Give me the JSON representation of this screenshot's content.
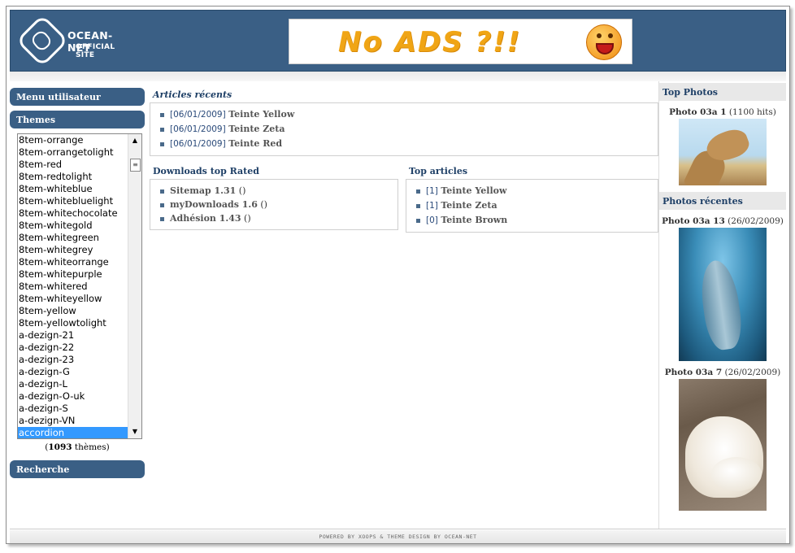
{
  "header": {
    "logo_title": "OCEAN-NET",
    "logo_subtitle": "OFFICIAL SITE",
    "banner_text": "No ADS ?!!",
    "brand_color": "#3a5f85"
  },
  "left": {
    "menu_title": "Menu utilisateur",
    "themes_title": "Themes",
    "themes": [
      "8tem-orrange",
      "8tem-orrangetolight",
      "8tem-red",
      "8tem-redtolight",
      "8tem-whiteblue",
      "8tem-whitebluelight",
      "8tem-whitechocolate",
      "8tem-whitegold",
      "8tem-whitegreen",
      "8tem-whitegrey",
      "8tem-whiteorrange",
      "8tem-whitepurple",
      "8tem-whitered",
      "8tem-whiteyellow",
      "8tem-yellow",
      "8tem-yellowtolight",
      "a-dezign-21",
      "a-dezign-22",
      "a-dezign-23",
      "a-dezign-G",
      "a-dezign-L",
      "a-dezign-O-uk",
      "a-dezign-S",
      "a-dezign-VN",
      "accordion"
    ],
    "selected_theme": "accordion",
    "theme_count_open": "(",
    "theme_count_number": "1093",
    "theme_count_suffix": " thèmes)",
    "search_title": "Recherche"
  },
  "center": {
    "recent_articles_title": "Articles récents",
    "recent_articles": [
      {
        "date": "[06/01/2009]",
        "title": "Teinte Yellow"
      },
      {
        "date": "[06/01/2009]",
        "title": "Teinte Zeta"
      },
      {
        "date": "[06/01/2009]",
        "title": "Teinte Red"
      }
    ],
    "downloads_title": "Downloads top Rated",
    "downloads": [
      {
        "name": "Sitemap 1.31",
        "extra": " ()"
      },
      {
        "name": "myDownloads 1.6",
        "extra": " ()"
      },
      {
        "name": "Adhésion 1.43",
        "extra": " ()"
      }
    ],
    "top_articles_title": "Top articles",
    "top_articles": [
      {
        "count": "[1]",
        "title": "Teinte Yellow"
      },
      {
        "count": "[1]",
        "title": "Teinte Zeta"
      },
      {
        "count": "[0]",
        "title": "Teinte Brown"
      }
    ]
  },
  "right": {
    "top_photos_title": "Top Photos",
    "top_photo_name": "Photo 03a 1",
    "top_photo_meta": " (1100 hits)",
    "recent_photos_title": "Photos récentes",
    "recent_photos": [
      {
        "name": "Photo 03a 13",
        "meta": " (26/02/2009)"
      },
      {
        "name": "Photo 03a 7",
        "meta": " (26/02/2009)"
      }
    ]
  },
  "footer": {
    "text": "POWERED BY XOOPS & THEME DESIGN BY OCEAN-NET"
  }
}
